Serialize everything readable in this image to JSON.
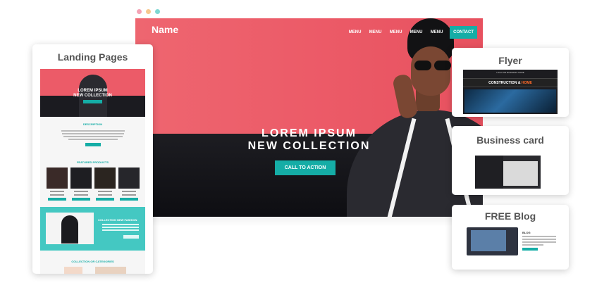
{
  "window": {
    "dots": [
      "#f4a3b5",
      "#f7c88e",
      "#7ed7d2"
    ]
  },
  "hero": {
    "logo": "Name",
    "nav": [
      "MENU",
      "MENU",
      "MENU",
      "MENU",
      "MENU"
    ],
    "contact": "CONTACT",
    "title_line1": "LOREM IPSUM",
    "title_line2": "NEW COLLECTION",
    "cta": "CALL TO ACTION"
  },
  "cards": {
    "landing": "Landing Pages",
    "flyer": "Flyer",
    "business_card": "Business card",
    "blog": "FREE Blog"
  },
  "landing_preview": {
    "hero_line1": "LOREM IPSUM",
    "hero_line2": "NEW COLLECTION",
    "description": "DESCRIPTION",
    "featured": "FEATURED PRODUCTS",
    "collection": "COLLECTION NEW FASHION",
    "categories": "COLLECTION OR CATEGORIES"
  },
  "flyer_preview": {
    "top": "LOGO OR BUSINESS NAME",
    "heading": "CONSTRUCTION & ",
    "heading_accent": "HOME"
  },
  "blog_preview": {
    "heading": "BLOG"
  },
  "colors": {
    "accent": "#15ada6",
    "hero_bg": "#ec5b68"
  }
}
